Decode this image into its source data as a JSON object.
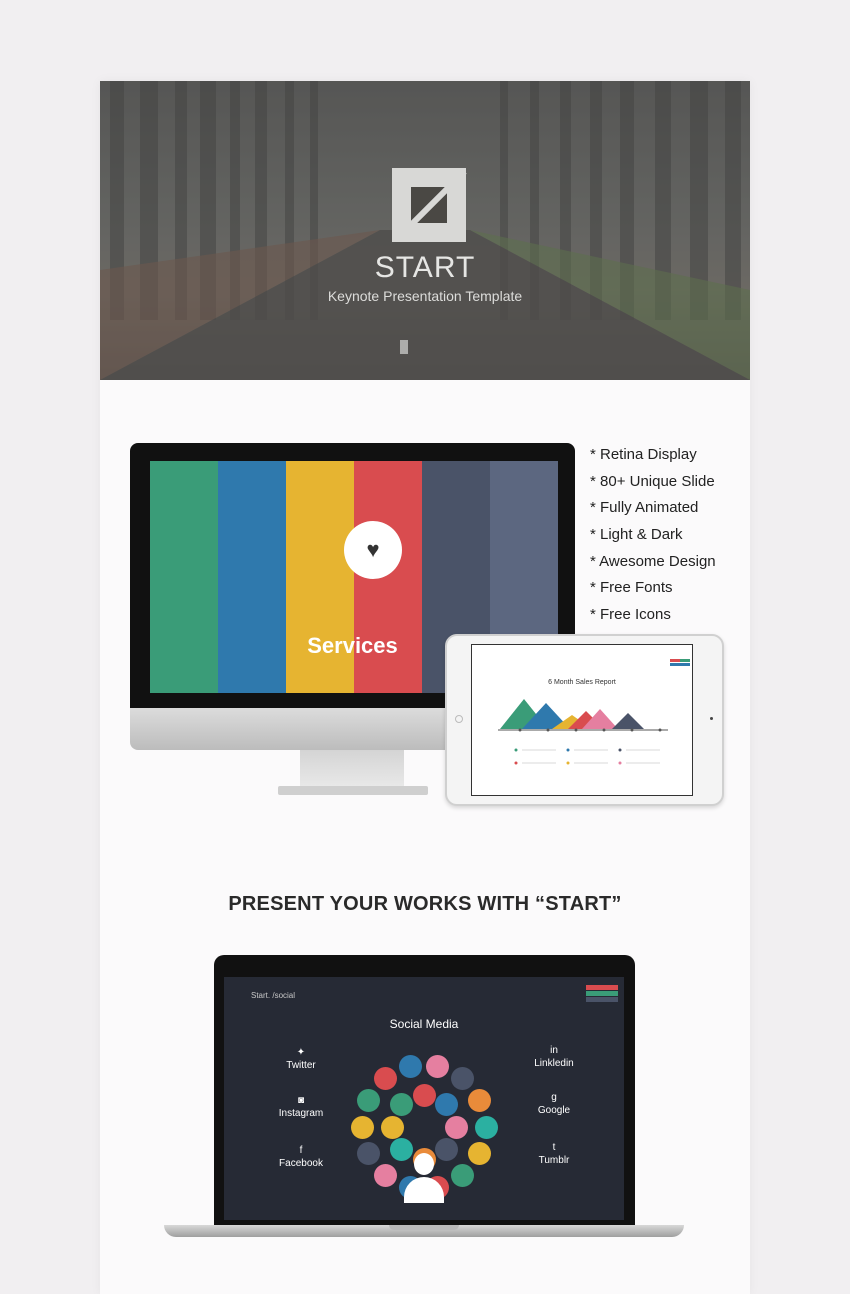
{
  "hero": {
    "title": "START",
    "subtitle": "Keynote Presentation  Template"
  },
  "monitor_slide": {
    "title": "Services",
    "icon": "heart-icon",
    "colors": [
      "#3a9c78",
      "#2f79ad",
      "#e6b431",
      "#d94c4f",
      "#4a5368",
      "#5c6780"
    ]
  },
  "tablet_slide": {
    "title": "6 Month Sales Report"
  },
  "features": [
    "* Retina Display",
    "* 80+ Unique Slide",
    "* Fully Animated",
    "* Light & Dark",
    "* Awesome Design",
    "* Free Fonts",
    "* Free Icons"
  ],
  "headline": "PRESENT YOUR WORKS WITH “START”",
  "laptop_slide": {
    "brand": "Start. /social",
    "title": "Social Media",
    "left": [
      {
        "name": "Twitter",
        "icon": "twitter-icon"
      },
      {
        "name": "Instagram",
        "icon": "instagram-icon"
      },
      {
        "name": "Facebook",
        "icon": "facebook-icon"
      }
    ],
    "right": [
      {
        "name": "Linkledin",
        "icon": "linkedin-icon"
      },
      {
        "name": "Google",
        "icon": "google-icon"
      },
      {
        "name": "Tumblr",
        "icon": "tumblr-icon"
      }
    ]
  }
}
